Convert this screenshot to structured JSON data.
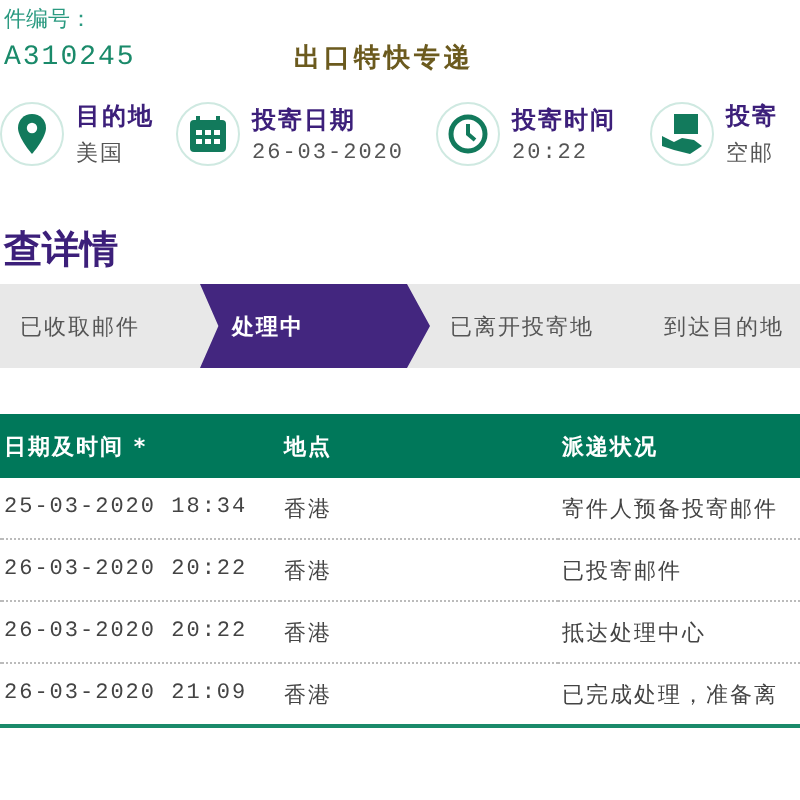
{
  "tracking": {
    "label": "件编号：",
    "number": "A310245",
    "service": "出口特快专递"
  },
  "info": [
    {
      "kind": "pin",
      "title": "目的地",
      "value": "美国"
    },
    {
      "kind": "calendar",
      "title": "投寄日期",
      "value": "26-03-2020"
    },
    {
      "kind": "clock",
      "title": "投寄时间",
      "value": "20:22"
    },
    {
      "kind": "handover",
      "title": "投寄",
      "value": "空邮"
    }
  ],
  "heading": "查详情",
  "steps": [
    {
      "label": "已收取邮件",
      "selected": false
    },
    {
      "label": "处理中",
      "selected": true
    },
    {
      "label": "已离开投寄地",
      "selected": false
    },
    {
      "label": "到达目的地",
      "selected": false
    }
  ],
  "table": {
    "columns": [
      "日期及时间 *",
      "地点",
      "派递状况"
    ],
    "rows": [
      [
        "25-03-2020 18:34",
        "香港",
        "寄件人预备投寄邮件"
      ],
      [
        "26-03-2020 20:22",
        "香港",
        "已投寄邮件"
      ],
      [
        "26-03-2020 20:22",
        "香港",
        "抵达处理中心"
      ],
      [
        "26-03-2020 21:09",
        "香港",
        "已完成处理，准备离"
      ]
    ]
  }
}
